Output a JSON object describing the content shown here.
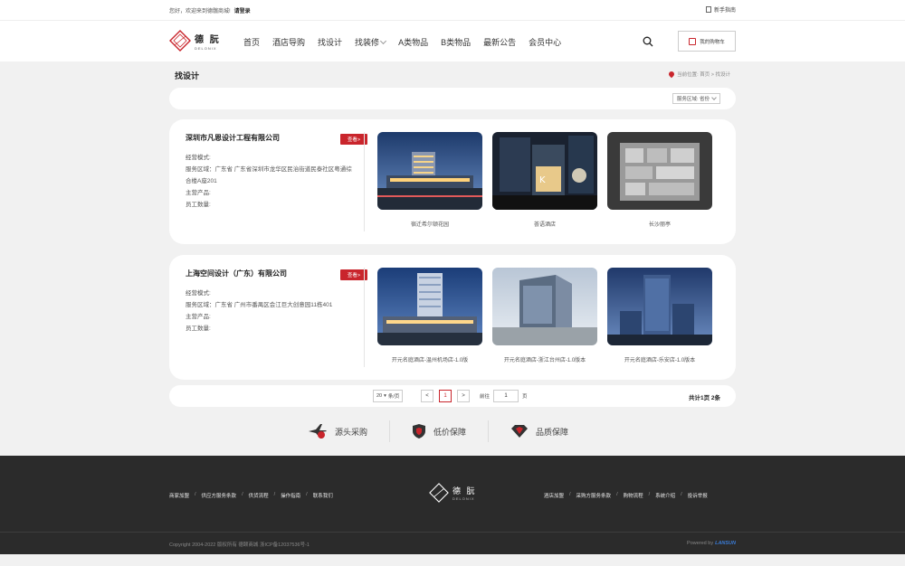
{
  "topbar": {
    "welcome": "您好，欢迎来到德髋商城!",
    "login": "请登录",
    "guide": "新手指南"
  },
  "brand": {
    "name_cn": "德 朊",
    "name_en": "DELONIX"
  },
  "nav": {
    "items": [
      "首页",
      "酒店导购",
      "找设计",
      "找装修",
      "A类物品",
      "B类物品",
      "最新公告",
      "会员中心"
    ],
    "cart": "我的购物车"
  },
  "page": {
    "title": "找设计",
    "breadcrumb": "当前位置: 首页 > 找设计"
  },
  "filter": {
    "label": "服务区域: 省份"
  },
  "companies": [
    {
      "name": "深圳市凡恩设计工程有限公司",
      "view": "查看>",
      "mode": "经营模式:",
      "area": "服务区域：广东省 广东省深圳市龙华区民治街道民泰社区粤通综合楼A座201",
      "products": "主营产品:",
      "staff": "员工数量:",
      "projects": [
        "宿迁希尔顿花园",
        "荟语酒店",
        "长沙丽亭"
      ]
    },
    {
      "name": "上海空间设计（广东）有限公司",
      "view": "查看>",
      "mode": "经营模式:",
      "area": "服务区域：广东省 广州市番禺区会江巨大创意园11栋401",
      "products": "主营产品:",
      "staff": "员工数量:",
      "projects": [
        "开元名庭酒店-温州机场店-1.0版",
        "开元名庭酒店-浙江台州店-1.0版本",
        "开元名庭酒店-乐安店-1.0版本"
      ]
    }
  ],
  "pager": {
    "size": "20",
    "size_unit": "条/页",
    "prev": "<",
    "current": "1",
    "next": ">",
    "goto": "前往",
    "goto_value": "1",
    "page_unit": "页",
    "total": "共计1页 2条"
  },
  "guarantees": [
    "源头采购",
    "低价保障",
    "品质保障"
  ],
  "footer": {
    "left_links": [
      "商家加盟",
      "供应方服务条款",
      "供货流程",
      "操作指南",
      "联系我们"
    ],
    "right_links": [
      "酒店加盟",
      "采购方服务条款",
      "购物流程",
      "系统介绍",
      "投诉举报"
    ],
    "separator": "/",
    "copyright": "Copyright 2004-2022 版权所有 德颐商城 浙ICP备12037536号-1",
    "powered": "Powered by",
    "powered_brand": "LANSUN"
  },
  "colors": {
    "accent": "#c9252c",
    "footer_bg": "#2b2b2b"
  }
}
